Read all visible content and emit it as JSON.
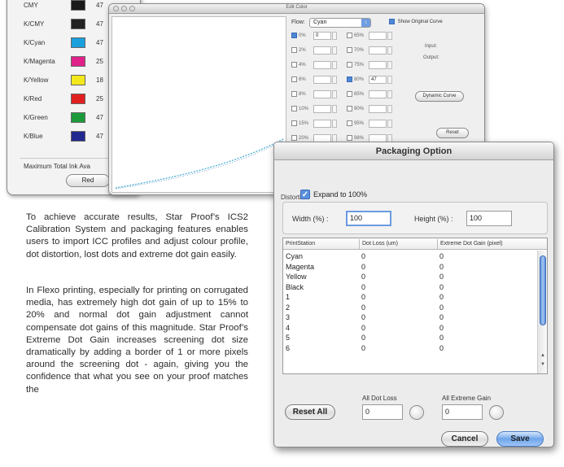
{
  "ink_limits": {
    "rows": [
      {
        "name": "CMY",
        "value": "47",
        "color": "#1a1a1a"
      },
      {
        "name": "K/CMY",
        "value": "47",
        "color": "#222222"
      },
      {
        "name": "K/Cyan",
        "value": "47",
        "color": "#1a9fdd"
      },
      {
        "name": "K/Magenta",
        "value": "25",
        "color": "#e0218a"
      },
      {
        "name": "K/Yellow",
        "value": "18",
        "color": "#f3e81b"
      },
      {
        "name": "K/Red",
        "value": "25",
        "color": "#e02020"
      },
      {
        "name": "K/Green",
        "value": "47",
        "color": "#1c9a3a"
      },
      {
        "name": "K/Blue",
        "value": "47",
        "color": "#23288f"
      }
    ],
    "max_total_label": "Maximum Total Ink Ava",
    "red_button": "Red"
  },
  "edit_color": {
    "title": "Edit Color",
    "flow_label": "Flow:",
    "flow_value": "Cyan",
    "show_original_label": "Show Original Curve",
    "left_points": [
      {
        "label": "0%",
        "value": "0",
        "checked": true
      },
      {
        "label": "2%",
        "value": "",
        "checked": false
      },
      {
        "label": "4%",
        "value": "",
        "checked": false
      },
      {
        "label": "6%",
        "value": "",
        "checked": false
      },
      {
        "label": "8%",
        "value": "",
        "checked": false
      },
      {
        "label": "10%",
        "value": "",
        "checked": false
      },
      {
        "label": "15%",
        "value": "",
        "checked": false
      },
      {
        "label": "20%",
        "value": "",
        "checked": false
      }
    ],
    "right_points": [
      {
        "label": "65%",
        "value": "",
        "checked": false
      },
      {
        "label": "70%",
        "value": "",
        "checked": false
      },
      {
        "label": "75%",
        "value": "",
        "checked": false
      },
      {
        "label": "80%",
        "value": "47",
        "checked": true
      },
      {
        "label": "85%",
        "value": "",
        "checked": false
      },
      {
        "label": "90%",
        "value": "",
        "checked": false
      },
      {
        "label": "95%",
        "value": "",
        "checked": false
      },
      {
        "label": "98%",
        "value": "",
        "checked": false
      }
    ],
    "input_label": "Input:",
    "output_label": "Output:",
    "dynamic_curve_button": "Dynamic Curve",
    "reset_button": "Reset"
  },
  "packaging": {
    "title": "Packaging Option",
    "distortion_label": "Distortion",
    "expand_label": "Expand to 100%",
    "width_label": "Width (%) :",
    "width_value": "100",
    "height_label": "Height (%) :",
    "height_value": "100",
    "columns": [
      "PrintStation",
      "Dot Loss (um)",
      "Extreme Dot Gain (pixel)"
    ],
    "rows": [
      [
        "Cyan",
        "0",
        "0"
      ],
      [
        "Magenta",
        "0",
        "0"
      ],
      [
        "Yellow",
        "0",
        "0"
      ],
      [
        "Black",
        "0",
        "0"
      ],
      [
        "1",
        "0",
        "0"
      ],
      [
        "2",
        "0",
        "0"
      ],
      [
        "3",
        "0",
        "0"
      ],
      [
        "4",
        "0",
        "0"
      ],
      [
        "5",
        "0",
        "0"
      ],
      [
        "6",
        "0",
        "0"
      ]
    ],
    "all_dot_loss_label": "All Dot Loss",
    "all_dot_loss_value": "0",
    "all_extreme_gain_label": "All Extreme Gain",
    "all_extreme_gain_value": "0",
    "reset_all_button": "Reset All",
    "cancel_button": "Cancel",
    "save_button": "Save"
  },
  "body": {
    "paragraph1": "To achieve accurate results, Star Proof’s ICS2 Calibration System and packaging features enables users to import ICC profiles and adjust colour profile, dot distortion, lost dots and extreme dot gain easily.",
    "paragraph2": "In Flexo printing, especially for printing on corrugated media, has extremely high dot gain of up to 15% to 20% and normal dot gain adjustment cannot compensate dot gains of this magnitude. Star Proof’s Extreme Dot Gain increases screening dot size dramatically by adding a border of 1 or more pixels around the screening dot - again, giving you the confidence that what you see on your proof matches the"
  }
}
